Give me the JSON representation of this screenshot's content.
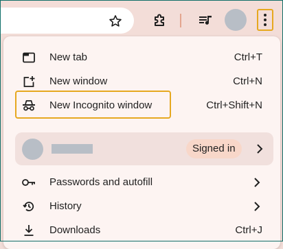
{
  "toolbar": {
    "icons": [
      "star-icon",
      "extensions-icon",
      "media-controls-icon",
      "profile-avatar",
      "more-menu-icon"
    ]
  },
  "menu": {
    "items": [
      {
        "label": "New tab",
        "shortcut": "Ctrl+T",
        "icon": "new-tab-icon"
      },
      {
        "label": "New window",
        "shortcut": "Ctrl+N",
        "icon": "new-window-icon"
      },
      {
        "label": "New Incognito window",
        "shortcut": "Ctrl+Shift+N",
        "icon": "incognito-icon"
      }
    ],
    "profile": {
      "status": "Signed in"
    },
    "sections": [
      {
        "label": "Passwords and autofill",
        "icon": "key-icon"
      },
      {
        "label": "History",
        "icon": "history-icon"
      },
      {
        "label": "Downloads",
        "shortcut": "Ctrl+J",
        "icon": "download-icon"
      }
    ]
  },
  "colors": {
    "toolbar_bg": "#f3ddd8",
    "menu_bg": "#fdf4f2",
    "highlight": "#e6a81f",
    "frame": "#0f6e68",
    "badge_bg": "#f8d7c9"
  }
}
